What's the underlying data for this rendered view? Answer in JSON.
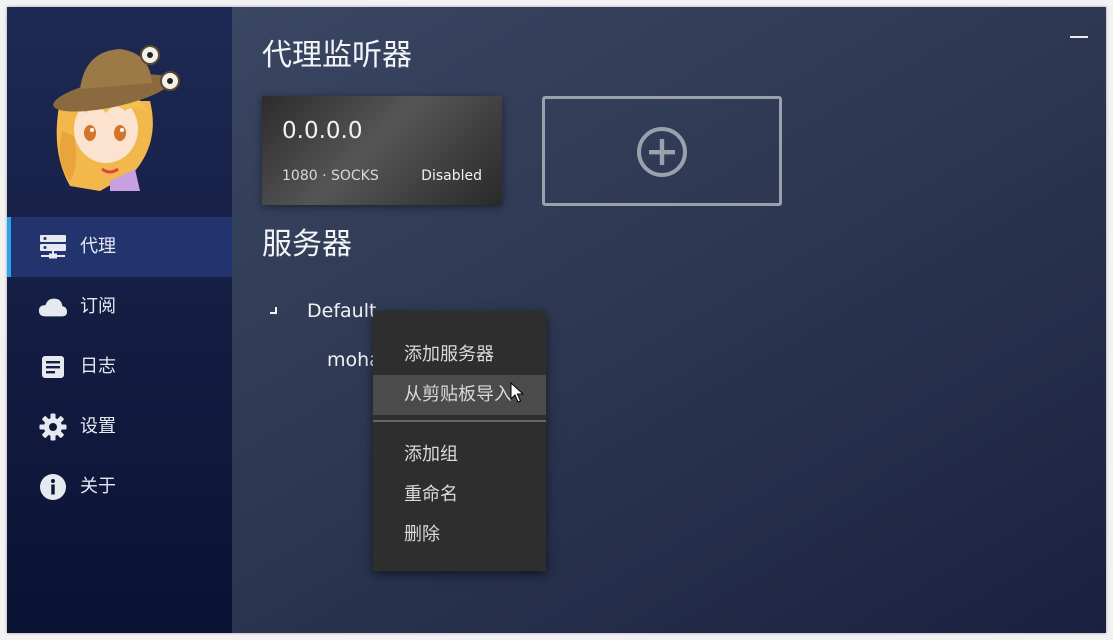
{
  "sidebar": {
    "items": [
      {
        "label": "代理",
        "icon": "server-icon",
        "active": true
      },
      {
        "label": "订阅",
        "icon": "cloud-icon",
        "active": false
      },
      {
        "label": "日志",
        "icon": "document-icon",
        "active": false
      },
      {
        "label": "设置",
        "icon": "gear-icon",
        "active": false
      },
      {
        "label": "关于",
        "icon": "info-icon",
        "active": false
      }
    ]
  },
  "main": {
    "listeners_title": "代理监听器",
    "listener": {
      "address": "0.0.0.0",
      "meta": "1080 · SOCKS",
      "status": "Disabled"
    },
    "servers_title": "服务器",
    "tree": {
      "group": "Default",
      "server": "mohaa"
    }
  },
  "context_menu": {
    "items": [
      "添加服务器",
      "从剪贴板导入",
      "添加组",
      "重命名",
      "删除"
    ],
    "hovered_index": 1
  },
  "colors": {
    "accent": "#29a4ee",
    "active_bg": "#23336e"
  }
}
